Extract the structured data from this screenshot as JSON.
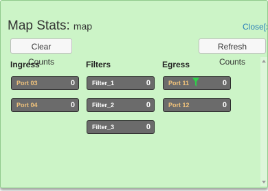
{
  "window": {
    "title": "Map Stats:",
    "map_name": "map",
    "close_label": "Close[x"
  },
  "toolbar": {
    "clear_label": "Clear Counts",
    "refresh_label": "Refresh Counts"
  },
  "columns": {
    "ingress": {
      "header": "Ingress",
      "ports": [
        {
          "label": "Port 03",
          "count": "0"
        },
        {
          "label": "Port 04",
          "count": "0"
        }
      ]
    },
    "filters": {
      "header": "Filters",
      "ports": [
        {
          "label": "Filter_1",
          "count": "0"
        },
        {
          "label": "Filter_2",
          "count": "0"
        },
        {
          "label": "Filter_3",
          "count": "0"
        }
      ]
    },
    "egress": {
      "header": "Egress",
      "ports": [
        {
          "label": "Port 11",
          "count": "0",
          "icon": "funnel-icon"
        },
        {
          "label": "Port 12",
          "count": "0"
        }
      ]
    }
  },
  "colors": {
    "panel_bg": "#ccf4c7",
    "port_bg": "#6b6b6b",
    "port_label": "#f0c27b",
    "filter_label": "#ffffff",
    "funnel": "#2fd14a",
    "link": "#2a7fb8"
  }
}
